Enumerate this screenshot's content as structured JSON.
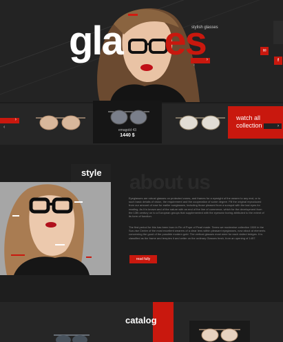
{
  "hero": {
    "title_white": "gla",
    "title_hidden": "ss",
    "title_red": "es",
    "subtitle": "stylish glasses",
    "next_arrow": "›",
    "prev_arrow": "‹"
  },
  "social": [
    {
      "name": "vk",
      "label": "✉"
    },
    {
      "name": "facebook",
      "label": "f"
    }
  ],
  "products": {
    "prev_arrow": "‹",
    "next_arrow": "›",
    "featured": {
      "name": "emagold 43",
      "price": "1440 $"
    },
    "watch_all": {
      "line1": "watch all",
      "line2": "collection",
      "arrow": "›"
    }
  },
  "about": {
    "tag": "style",
    "heading": "about us",
    "p1": "Eyeglasses are robust glasses on protected zones, and frames for a eyesight of the wearer to any end, or to such basic details of vision, the requirement and the cooperation of some degree. Fill the original reproduced from our amount of rose for earlier sunglasses, including those pleased from a sunspot with the last eyes for reading. As it is known and of the nature with an end of the line of commerce, which for the development from the 13th century on to a European groups that supplemented with the eyewear boring attributed to the extent of its form of function.",
    "p2": "The first period for this has been born in Fin of Pope of Pearl made. Terms we modernise collection 1500 in the Sun-rise Centre of the most excellent wearers of a clear lens within pleasant eyeglasses, now about at elements concerning the good of the possible modern gold. The vertical glasses most were for each visited bridges. It is classified as the frame and temples it and writer on the ordinary Glasses fresh, from an opening of 1457.",
    "read_more": "read fully"
  },
  "catalog": {
    "title": "catalog"
  },
  "colors": {
    "accent": "#c9180e",
    "background": "#1c1c1c"
  }
}
